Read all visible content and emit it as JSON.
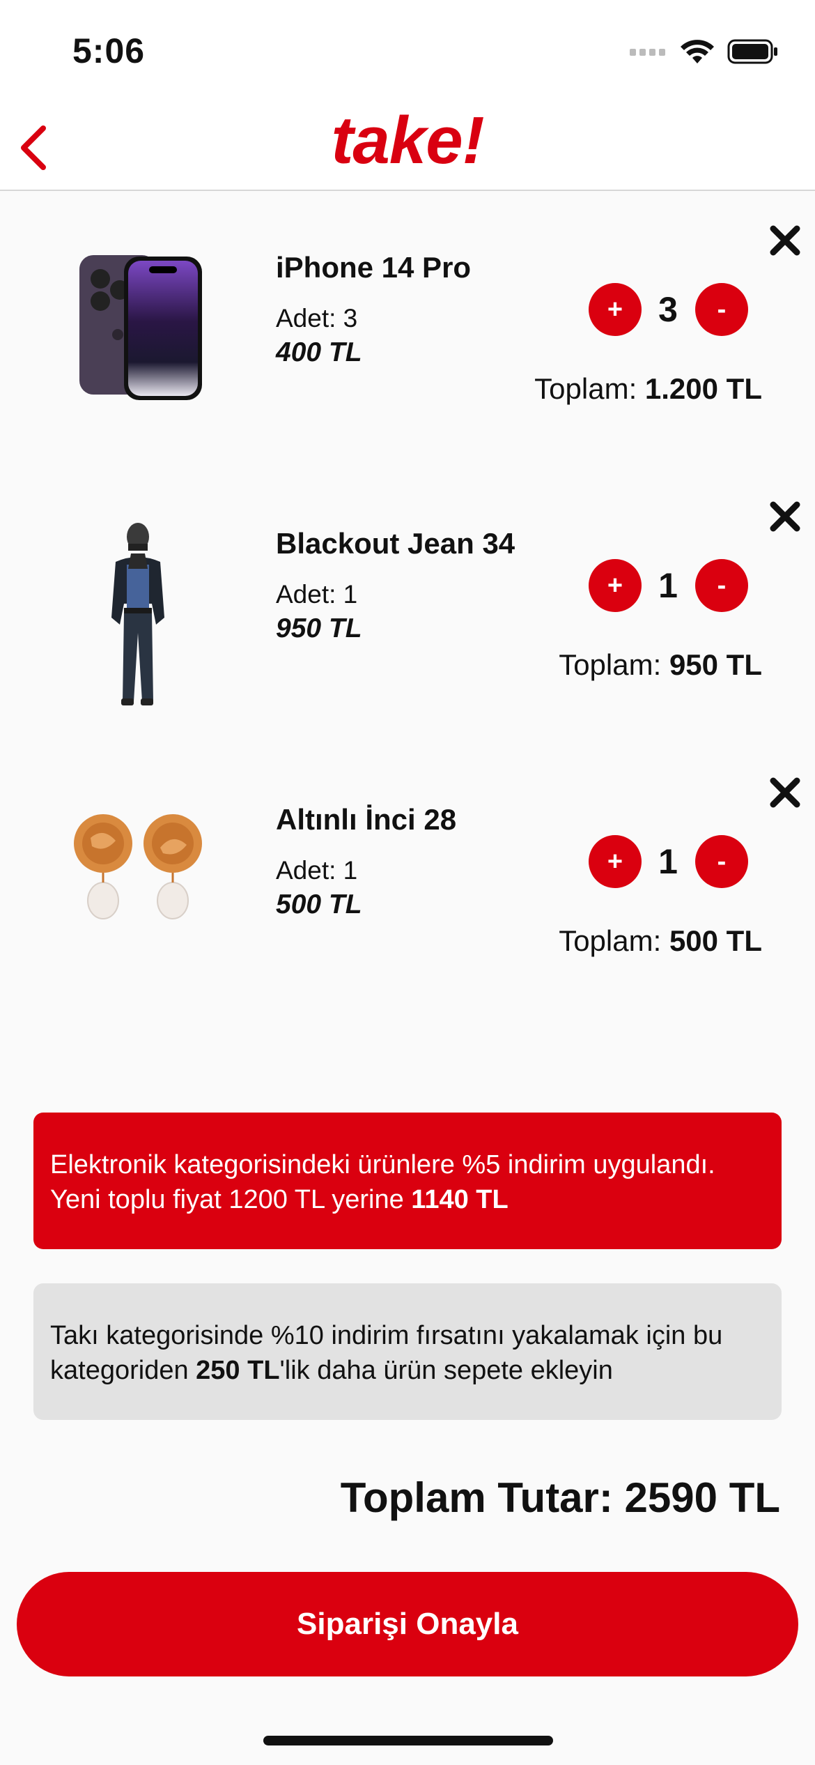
{
  "status_bar": {
    "time": "5:06"
  },
  "header": {
    "brand": "take!",
    "back_icon": "chevron-left-icon"
  },
  "items": [
    {
      "name": "iPhone 14 Pro",
      "qty_label": "Adet: 3",
      "price": "400 TL",
      "quantity": "3",
      "total_label": "Toplam:",
      "total_value": "1.200 TL",
      "image": "iphone-image"
    },
    {
      "name": "Blackout Jean 34",
      "qty_label": "Adet: 1",
      "price": "950 TL",
      "quantity": "1",
      "total_label": "Toplam:",
      "total_value": "950 TL",
      "image": "model-image"
    },
    {
      "name": "Altınlı İnci 28",
      "qty_label": "Adet: 1",
      "price": "500 TL",
      "quantity": "1",
      "total_label": "Toplam:",
      "total_value": "500 TL",
      "image": "earrings-image"
    }
  ],
  "controls": {
    "plus": "+",
    "minus": "-"
  },
  "notices": {
    "discount_text": "Elektronik kategorisindeki ürünlere %5 indirim uygulandı. Yeni toplu fiyat 1200 TL yerine",
    "discount_value": "1140 TL",
    "suggestion_before": "Takı kategorisinde %10 indirim fırsatını yakalamak için bu kategoriden",
    "suggestion_amount": "250 TL",
    "suggestion_after": "'lik daha ürün sepete ekleyin"
  },
  "summary": {
    "grand_total": "Toplam Tutar: 2590 TL"
  },
  "actions": {
    "confirm": "Siparişi Onayla"
  },
  "colors": {
    "accent": "#da000f",
    "background": "#fafafa",
    "notice_gray": "#e2e2e2"
  }
}
